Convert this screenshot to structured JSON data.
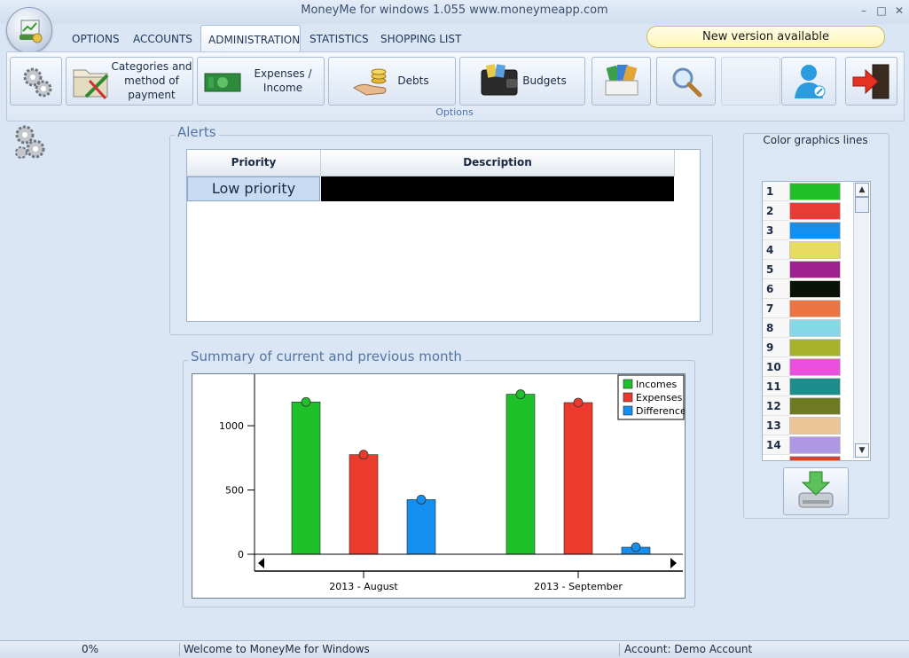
{
  "window": {
    "title": "MoneyMe for windows 1.055 www.moneymeapp.com"
  },
  "tabs": [
    {
      "label": "OPTIONS"
    },
    {
      "label": "ACCOUNTS"
    },
    {
      "label": "ADMINISTRATION"
    },
    {
      "label": "STATISTICS"
    },
    {
      "label": "SHOPPING LIST"
    }
  ],
  "notice": "New version available",
  "ribbon": {
    "categories_label": "Categories and method of payment",
    "expenses_label": "Expenses / Income",
    "debts_label": "Debts",
    "budgets_label": "Budgets",
    "group_label": "Options"
  },
  "alerts": {
    "title": "Alerts",
    "columns": [
      "Priority",
      "Description"
    ],
    "rows": [
      {
        "priority": "Low priority",
        "description": ""
      }
    ]
  },
  "summary": {
    "title": "Summary of current and previous month"
  },
  "chart_data": {
    "type": "bar",
    "categories": [
      "2013 - August",
      "2013 - September"
    ],
    "series": [
      {
        "name": "Incomes",
        "color": "#1fc12b",
        "values": [
          1185,
          1245
        ]
      },
      {
        "name": "Expenses",
        "color": "#ec3a2d",
        "values": [
          775,
          1180
        ]
      },
      {
        "name": "Difference",
        "color": "#138ff0",
        "values": [
          425,
          55
        ]
      }
    ],
    "yticks": [
      0,
      500,
      1000
    ],
    "ylim": [
      0,
      1380
    ],
    "legend": "top-right",
    "grid": false
  },
  "color_lines": {
    "title": "Color graphics lines",
    "items": [
      {
        "n": "1",
        "color": "#20c02a"
      },
      {
        "n": "2",
        "color": "#e93b35"
      },
      {
        "n": "3",
        "color": "#138ff0"
      },
      {
        "n": "4",
        "color": "#e7dc60"
      },
      {
        "n": "5",
        "color": "#a0208f"
      },
      {
        "n": "6",
        "color": "#0b1207"
      },
      {
        "n": "7",
        "color": "#ec7442"
      },
      {
        "n": "8",
        "color": "#85d9e6"
      },
      {
        "n": "9",
        "color": "#a7b12a"
      },
      {
        "n": "10",
        "color": "#ea4fe0"
      },
      {
        "n": "11",
        "color": "#1d8d8c"
      },
      {
        "n": "12",
        "color": "#6e7a22"
      },
      {
        "n": "13",
        "color": "#ecc696"
      },
      {
        "n": "14",
        "color": "#ae97e3"
      }
    ]
  },
  "status": {
    "progress": "0%",
    "message": "Welcome to MoneyMe for Windows",
    "account": "Account: Demo Account"
  }
}
